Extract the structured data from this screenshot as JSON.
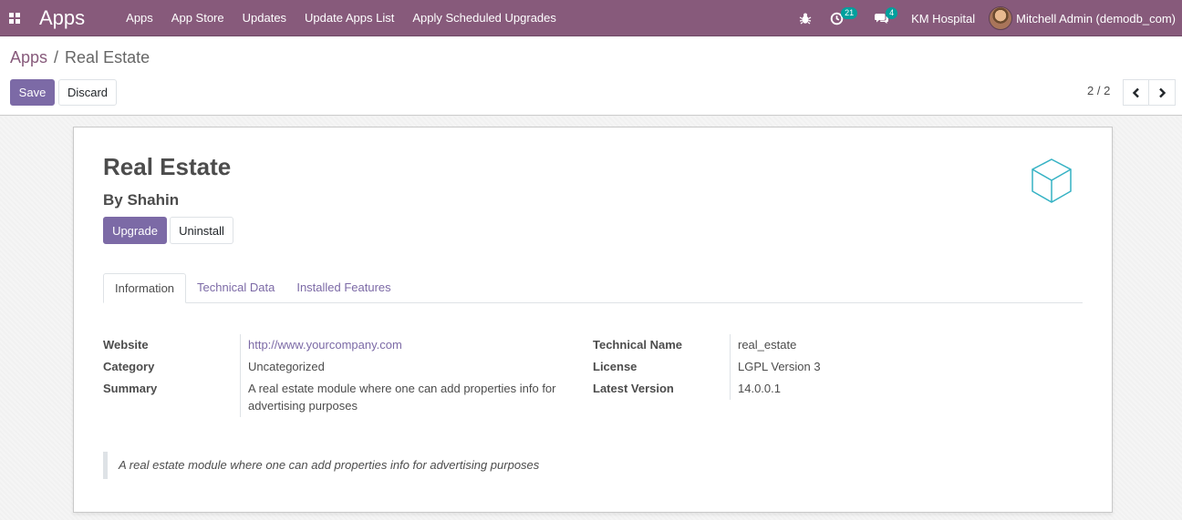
{
  "navbar": {
    "brand": "Apps",
    "menu": [
      "Apps",
      "App Store",
      "Updates",
      "Update Apps List",
      "Apply Scheduled Upgrades"
    ],
    "activities_count": "21",
    "messages_count": "4",
    "company": "KM Hospital",
    "user": "Mitchell Admin (demodb_com)"
  },
  "breadcrumb": {
    "parent": "Apps",
    "separator": "/",
    "current": "Real Estate"
  },
  "actions": {
    "save": "Save",
    "discard": "Discard"
  },
  "pager": {
    "value": "2 / 2"
  },
  "module": {
    "name": "Real Estate",
    "author": "By Shahin",
    "upgrade": "Upgrade",
    "uninstall": "Uninstall"
  },
  "tabs": [
    "Information",
    "Technical Data",
    "Installed Features"
  ],
  "info_left": [
    {
      "label": "Website",
      "value": "http://www.yourcompany.com"
    },
    {
      "label": "Category",
      "value": "Uncategorized"
    },
    {
      "label": "Summary",
      "value": "A real estate module where one can add properties info for advertising purposes"
    }
  ],
  "info_right": [
    {
      "label": "Technical Name",
      "value": "real_estate"
    },
    {
      "label": "License",
      "value": "LGPL Version 3"
    },
    {
      "label": "Latest Version",
      "value": "14.0.0.1"
    }
  ],
  "description": "A real estate module where one can add properties info for advertising purposes",
  "icons": {
    "apps_menu": "grid-icon",
    "debug": "bug-icon",
    "activities": "clock-icon",
    "messages": "chat-icon",
    "prev": "chevron-left-icon",
    "next": "chevron-right-icon",
    "module": "cube-icon"
  },
  "colors": {
    "navbar": "#875a7b",
    "primary": "#7c6aa6",
    "badge": "#00a09d",
    "cube": "#35b2c4"
  }
}
